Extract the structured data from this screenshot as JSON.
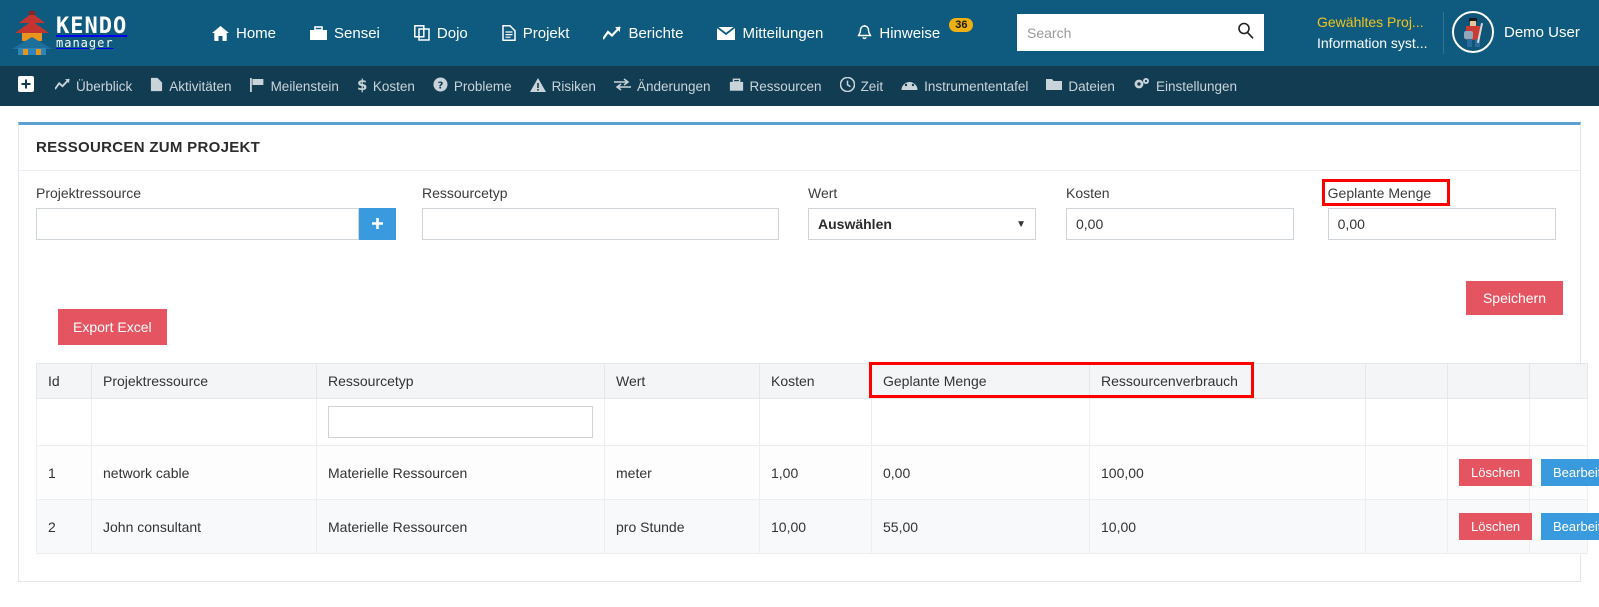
{
  "brand": {
    "line1": "KENDO",
    "line2": "manager",
    "logo_icon": "pagoda-logo-icon"
  },
  "navbar": {
    "items": [
      {
        "label": "Home",
        "icon": "home-icon"
      },
      {
        "label": "Sensei",
        "icon": "briefcase-icon"
      },
      {
        "label": "Dojo",
        "icon": "copy-icon"
      },
      {
        "label": "Projekt",
        "icon": "file-icon"
      },
      {
        "label": "Berichte",
        "icon": "chart-line-icon"
      },
      {
        "label": "Mitteilungen",
        "icon": "envelope-icon"
      },
      {
        "label": "Hinweise",
        "icon": "bell-icon",
        "badge": "36"
      }
    ],
    "search": {
      "value": "",
      "placeholder": "Search",
      "icon": "search-icon"
    },
    "project": {
      "name": "Gewähltes Proj...",
      "subtitle": "Information syst..."
    },
    "user": {
      "name": "Demo User",
      "avatar_icon": "kendo-avatar-icon"
    }
  },
  "subnav": {
    "plus_icon": "plus-square-icon",
    "items": [
      {
        "label": "Überblick",
        "icon": "chart-line-icon"
      },
      {
        "label": "Aktivitäten",
        "icon": "file-lines-icon"
      },
      {
        "label": "Meilenstein",
        "icon": "flag-icon"
      },
      {
        "label": "Kosten",
        "icon": "dollar-icon"
      },
      {
        "label": "Probleme",
        "icon": "question-circle-icon"
      },
      {
        "label": "Risiken",
        "icon": "warning-triangle-icon"
      },
      {
        "label": "Änderungen",
        "icon": "exchange-icon"
      },
      {
        "label": "Ressourcen",
        "icon": "briefcase-icon"
      },
      {
        "label": "Zeit",
        "icon": "clock-icon"
      },
      {
        "label": "Instrumententafel",
        "icon": "dashboard-icon"
      },
      {
        "label": "Dateien",
        "icon": "folder-icon"
      },
      {
        "label": "Einstellungen",
        "icon": "gears-icon"
      }
    ]
  },
  "panel": {
    "title": "RESSOURCEN ZUM PROJEKT",
    "form": {
      "projektressource": {
        "label": "Projektressource",
        "value": "",
        "placeholder": ""
      },
      "add_button_icon": "plus-icon",
      "ressourcetyp": {
        "label": "Ressourcetyp",
        "value": "",
        "placeholder": ""
      },
      "wert": {
        "label": "Wert",
        "selected": "Auswählen",
        "caret_icon": "chevron-down-icon"
      },
      "kosten": {
        "label": "Kosten",
        "value": "0,00"
      },
      "geplante_menge": {
        "label": "Geplante Menge",
        "value": "0,00",
        "highlighted": true
      }
    },
    "save_button": "Speichern",
    "export_button": "Export Excel"
  },
  "table": {
    "columns": [
      "Id",
      "Projektressource",
      "Ressourcetyp",
      "Wert",
      "Kosten",
      "Geplante Menge",
      "Ressourcenverbrauch",
      "",
      "",
      ""
    ],
    "highlighted_columns": [
      "Geplante Menge",
      "Ressourcenverbrauch"
    ],
    "filter_row": {
      "ressourcetyp_filter": ""
    },
    "rows": [
      {
        "id": "1",
        "projektressource": "network cable",
        "ressourcetyp": "Materielle Ressourcen",
        "wert": "meter",
        "kosten": "1,00",
        "geplante_menge": "0,00",
        "ressourcenverbrauch": "100,00",
        "delete_label": "Löschen",
        "edit_label": "Bearbeiten"
      },
      {
        "id": "2",
        "projektressource": "John consultant",
        "ressourcetyp": "Materielle Ressourcen",
        "wert": "pro Stunde",
        "kosten": "10,00",
        "geplante_menge": "55,00",
        "ressourcenverbrauch": "10,00",
        "delete_label": "Löschen",
        "edit_label": "Bearbeiten"
      }
    ]
  },
  "colors": {
    "navbar_bg": "#0f5b80",
    "subnav_bg": "#123c52",
    "accent_blue": "#3a9ade",
    "accent_red": "#e55561",
    "badge_gold": "#eeb111",
    "project_gold": "#f0c419",
    "highlight_red": "#ff0000",
    "panel_top_border": "#5ba0d0"
  }
}
